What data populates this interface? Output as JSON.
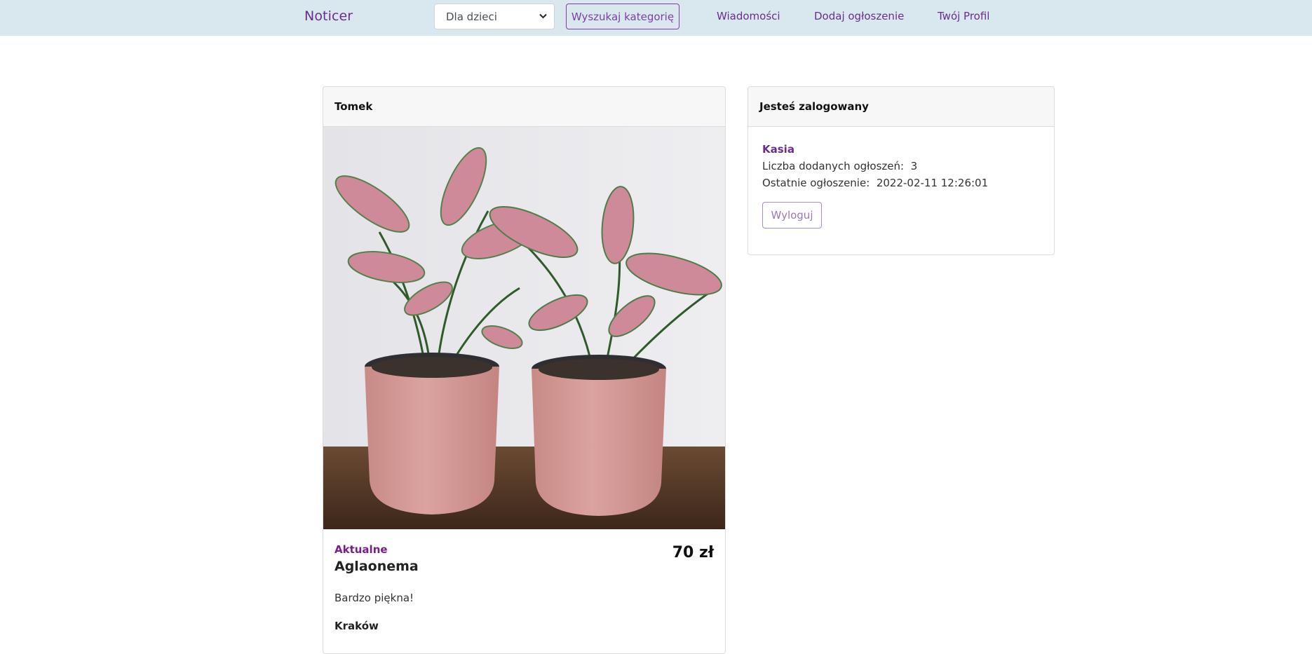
{
  "navbar": {
    "brand": "Noticer",
    "category_select": {
      "selected": "Dla dzieci"
    },
    "search_button": "Wyszukaj kategorię",
    "links": [
      "Wiadomości",
      "Dodaj ogłoszenie",
      "Twój Profil"
    ]
  },
  "post": {
    "author": "Tomek",
    "status": "Aktualne",
    "title": "Aglaonema",
    "price": "70 zł",
    "description": "Bardzo piękna!",
    "city": "Kraków"
  },
  "login_panel": {
    "header": "Jesteś zalogowany",
    "user_name": "Kasia",
    "ads_count_label": "Liczba dodanych ogłoszeń:",
    "ads_count_value": "3",
    "last_ad_label": "Ostatnie ogłoszenie:",
    "last_ad_value": "2022-02-11 12:26:01",
    "logout_button": "Wyloguj"
  },
  "icons": {
    "select_arrow": "chevron-down-icon"
  },
  "colors": {
    "accent": "#6a2c8f",
    "navbar_bg": "#d9e8ee",
    "status": "#7a1f8a"
  }
}
